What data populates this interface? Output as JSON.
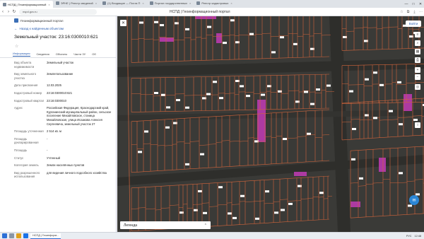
{
  "browser": {
    "tabs": [
      {
        "label": "НСПД | Геоинформационный",
        "active": true
      },
      {
        "label": "ЭРНЕ | Реестр сведений",
        "active": false
      },
      {
        "label": "(1) Входящие — Почта П",
        "active": false
      },
      {
        "label": "Портал государственных",
        "active": false
      },
      {
        "label": "Реестр кадастровых",
        "active": false
      }
    ],
    "url": "nspd.gov.ru",
    "page_title": "НСПД | Геоинформационный портал",
    "win_controls": [
      "—",
      "□",
      "✕"
    ]
  },
  "panel": {
    "portal_title": "Геоинформационный портал",
    "back_label": "Назад к найденным объектам",
    "parcel_title": "Земельный участок: 23:16:0300010:621",
    "tabs": [
      "Информация",
      "Сведения",
      "Объекты",
      "Части ЗУ",
      "Об"
    ],
    "attributes": [
      {
        "key": "Вид объекта недвижимости",
        "value": "Земельный участок"
      },
      {
        "key": "Вид земельного участка",
        "value": "Землепользование"
      },
      {
        "key": "Дата присвоения",
        "value": "12.03.2025"
      },
      {
        "key": "Кадастровый номер",
        "value": "23:16:0300010:621"
      },
      {
        "key": "Кадастровый квартал",
        "value": "23:16:0300010"
      },
      {
        "key": "Адрес",
        "value": "Российская Федерация, Краснодарский край, Курганинский муниципальный район, сельское поселение Михайловское, станица Михайловская, улица Исаакова Алексея Сергеевича, земельный участок 27"
      },
      {
        "key": "Площадь уточненная",
        "value": "2 514 кв. м"
      },
      {
        "key": "Площадь декларированная",
        "value": "-"
      },
      {
        "key": "Площадь",
        "value": "-"
      },
      {
        "key": "Статус",
        "value": "Учтенный"
      },
      {
        "key": "Категория земель",
        "value": "Земли населённых пунктов"
      },
      {
        "key": "Вид разрешенного использования",
        "value": "для ведения личного подсобного хозяйства"
      }
    ]
  },
  "map": {
    "login_label": "Войти",
    "legend_label": "Легенда",
    "colors": {
      "background": "#3a3a37",
      "parcel_line": "#d2653c",
      "zone": "#c23bb5",
      "label_bg": "#ffffff"
    }
  },
  "taskbar": {
    "app_label": "НСПД | Геоинформ...",
    "clock": "12:48",
    "lang": "РУС"
  }
}
